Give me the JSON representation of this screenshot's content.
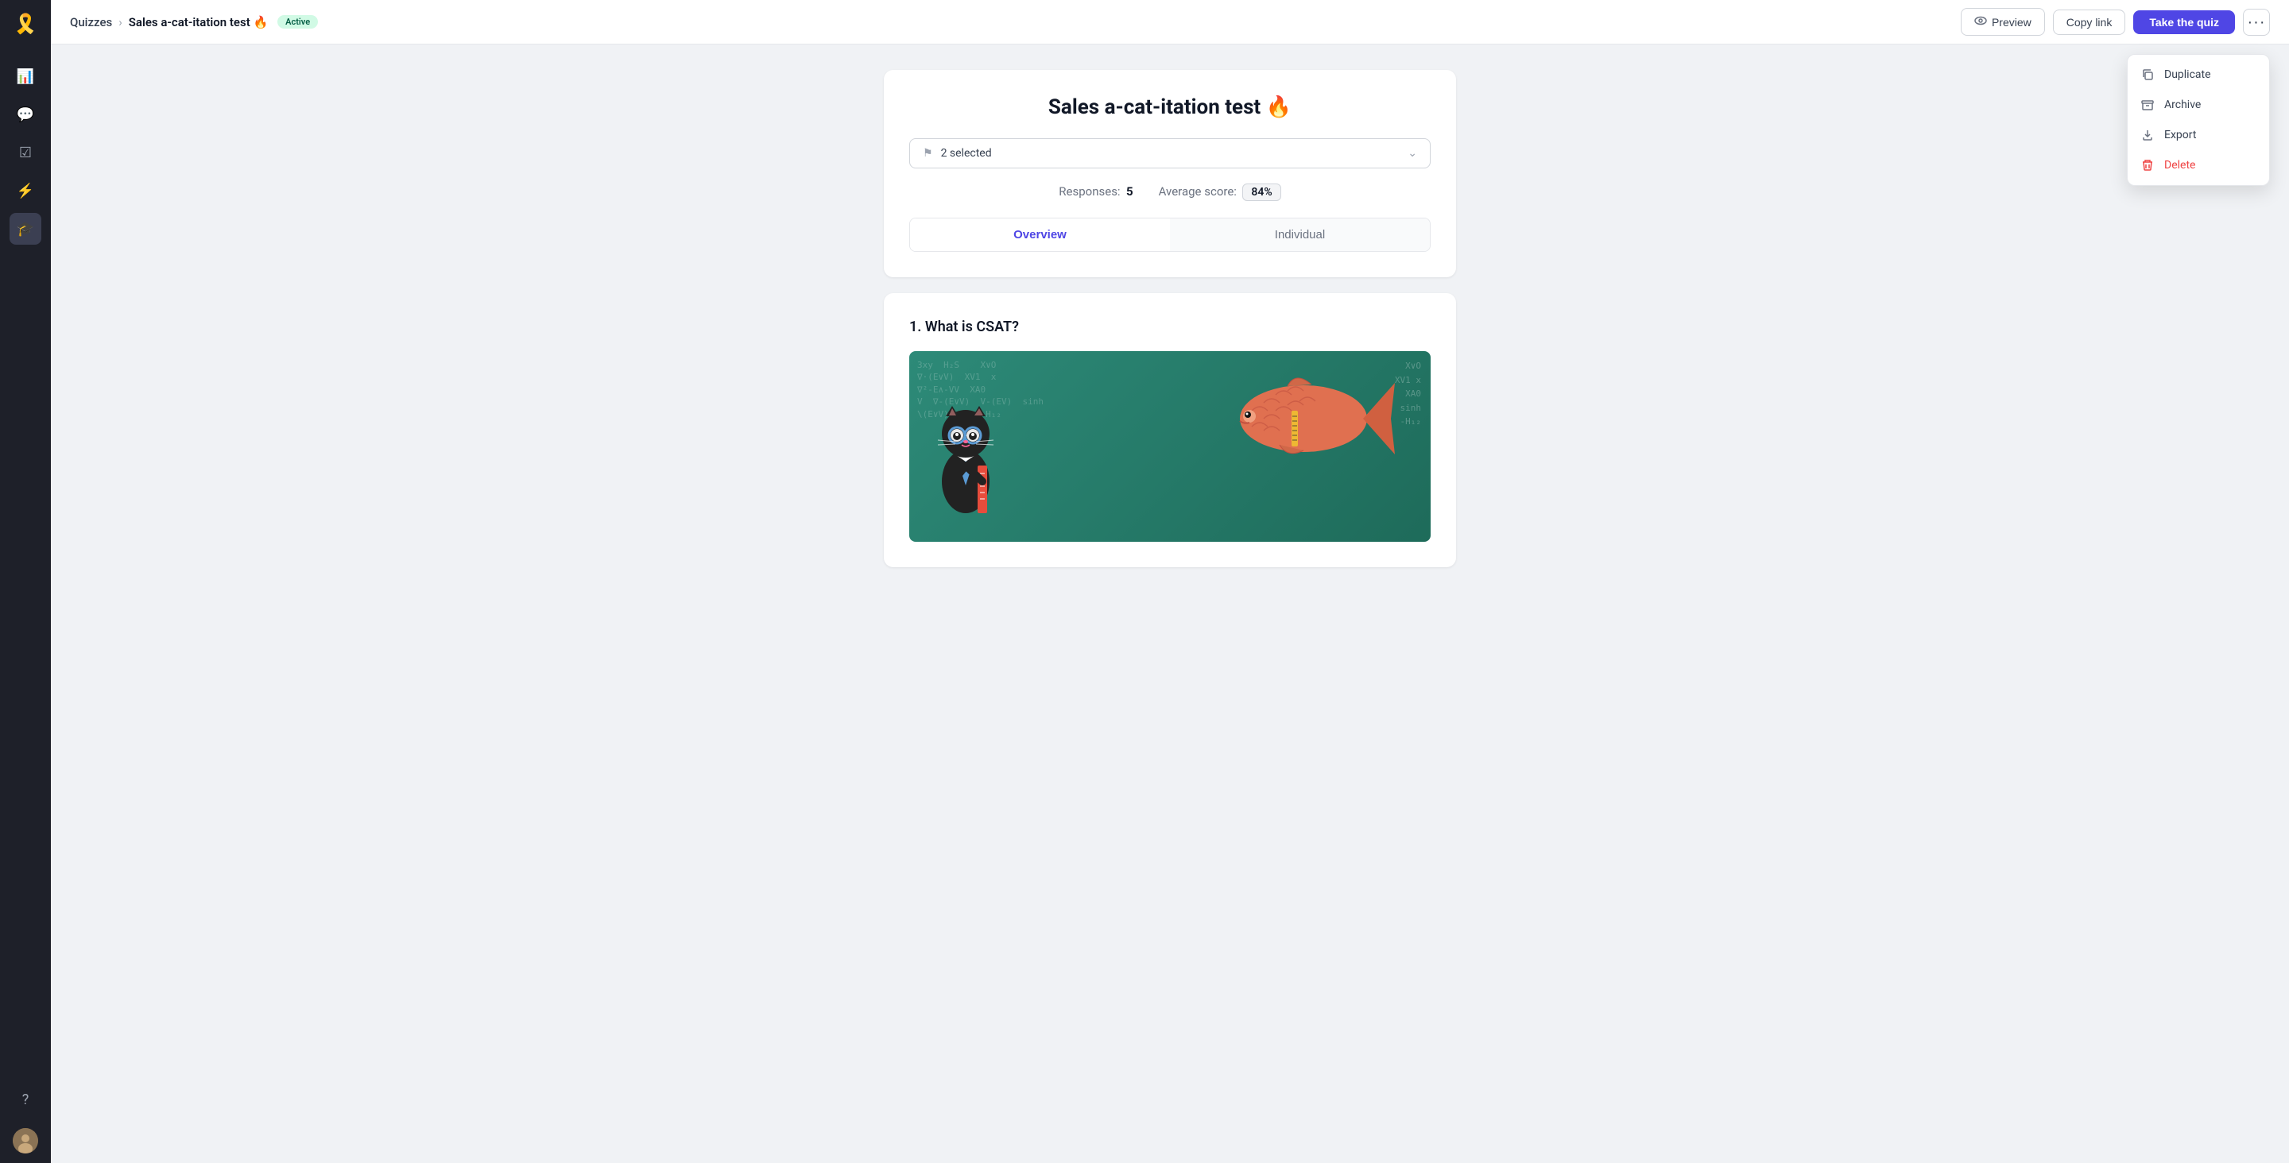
{
  "sidebar": {
    "logo_emoji": "🎗️",
    "items": [
      {
        "id": "analytics",
        "icon": "📊",
        "active": false
      },
      {
        "id": "messages",
        "icon": "💬",
        "active": false
      },
      {
        "id": "tasks",
        "icon": "✅",
        "active": false
      },
      {
        "id": "lightning",
        "icon": "⚡",
        "active": false
      },
      {
        "id": "learn",
        "icon": "🎓",
        "active": true
      }
    ],
    "bottom": [
      {
        "id": "help",
        "icon": "❓"
      }
    ],
    "avatar_initials": "👤"
  },
  "header": {
    "breadcrumb": {
      "parent": "Quizzes",
      "separator": "›",
      "current": "Sales a-cat-itation test",
      "emoji": "🔥"
    },
    "status_badge": "Active",
    "actions": {
      "preview_label": "Preview",
      "copy_link_label": "Copy link",
      "take_quiz_label": "Take the quiz",
      "more_icon": "···"
    }
  },
  "dropdown_menu": {
    "items": [
      {
        "id": "duplicate",
        "label": "Duplicate",
        "icon": "copy"
      },
      {
        "id": "archive",
        "label": "Archive",
        "icon": "archive"
      },
      {
        "id": "export",
        "label": "Export",
        "icon": "export"
      },
      {
        "id": "delete",
        "label": "Delete",
        "icon": "trash",
        "danger": true
      }
    ]
  },
  "quiz_card": {
    "title": "Sales a-cat-itation test",
    "title_emoji": "🔥",
    "filter": {
      "placeholder": "2 selected",
      "flag_icon": "⚑"
    },
    "stats": {
      "responses_label": "Responses:",
      "responses_value": "5",
      "avg_score_label": "Average score:",
      "avg_score_value": "84%"
    },
    "tabs": [
      {
        "id": "overview",
        "label": "Overview",
        "active": true
      },
      {
        "id": "individual",
        "label": "Individual",
        "active": false
      }
    ]
  },
  "question_1": {
    "number": "1.",
    "title": "What is CSAT?",
    "has_image": true,
    "image_alt": "Cat teacher with fish on chalkboard"
  },
  "chalkboard": {
    "chalk_content": "3xy  H₂S    X∨O\n∇·(E∨V)  XV1  x\n∇²-E∧-VV  XA0\nV  ∇-(E∨V)  V-(EV)  sinh\n\\(E∨V)  1/2E-H₁₂"
  }
}
